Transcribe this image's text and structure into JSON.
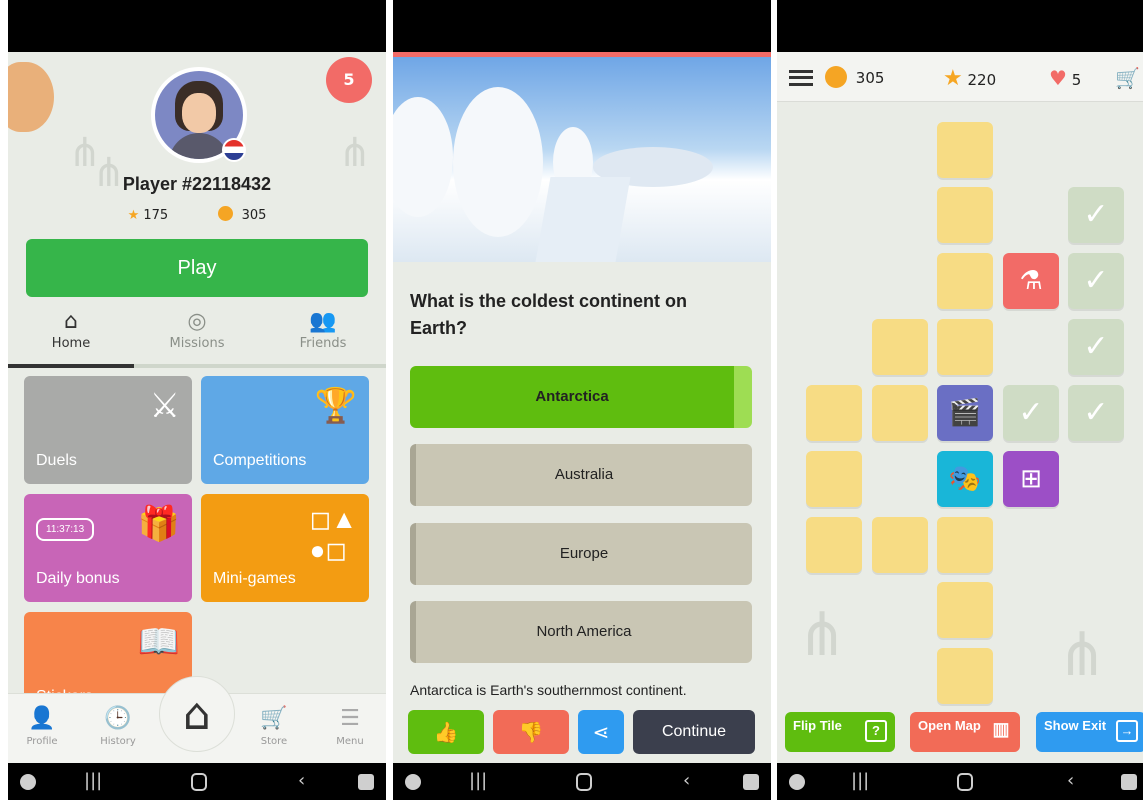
{
  "screen1": {
    "hearts": "5",
    "player_name": "Player #22118432",
    "stars": "175",
    "coins": "305",
    "play_label": "Play",
    "tabs": [
      {
        "label": "Home",
        "icon": "home-icon"
      },
      {
        "label": "Missions",
        "icon": "target-icon"
      },
      {
        "label": "Friends",
        "icon": "friends-icon"
      }
    ],
    "tiles": {
      "duels": "Duels",
      "competitions": "Competitions",
      "daily_bonus": "Daily bonus",
      "timer": "11:37:13",
      "mini_games": "Mini-games",
      "stickers": "Stickers"
    },
    "bottom_nav": [
      "Profile",
      "History",
      "Store",
      "Menu"
    ],
    "colors": {
      "play": "#36b54a",
      "duels": "#a9aaa8",
      "competitions": "#5fa8e6",
      "daily_bonus": "#c865b7",
      "mini_games": "#f39c12",
      "stickers": "#f7844a"
    }
  },
  "screen2": {
    "question": "What is the coldest continent on Earth?",
    "answers": [
      "Antarctica",
      "Australia",
      "Europe",
      "North America"
    ],
    "correct_index": 0,
    "explanation": "Antarctica is Earth's southernmost continent.",
    "continue_label": "Continue"
  },
  "screen3": {
    "coins": "305",
    "stars": "220",
    "hearts": "5",
    "flip_tile": "Flip Tile",
    "flip_tile_icon": "?",
    "open_map": "Open Map",
    "show_exit": "Show Exit"
  }
}
